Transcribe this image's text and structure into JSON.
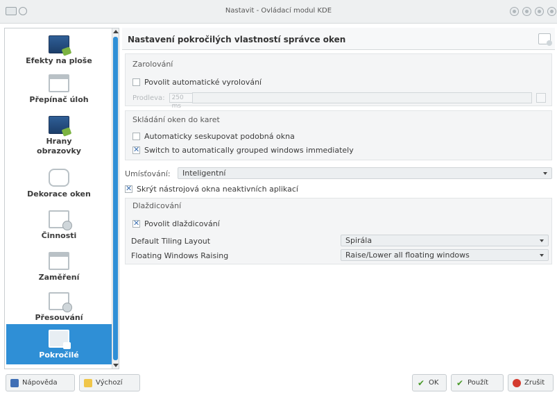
{
  "window": {
    "title": "Nastavit - Ovládací modul KDE"
  },
  "sidebar": {
    "items": [
      {
        "label": "Efekty na ploše",
        "icon": "monitor-effects-icon"
      },
      {
        "label": "Přepínač úloh",
        "icon": "window-switcher-icon"
      },
      {
        "label": "Hrany obrazovky",
        "icon": "screen-edges-icon"
      },
      {
        "label": "Dekorace oken",
        "icon": "window-decoration-icon"
      },
      {
        "label": "Činnosti",
        "icon": "actions-icon"
      },
      {
        "label": "Zaměření",
        "icon": "focus-icon"
      },
      {
        "label": "Přesouvání",
        "icon": "moving-icon"
      },
      {
        "label": "Pokročilé",
        "icon": "advanced-icon",
        "selected": true
      }
    ]
  },
  "main": {
    "title": "Nastavení pokročilých vlastností správce oken",
    "shading": {
      "title": "Zarolování",
      "auto_unshade": {
        "label": "Povolit automatické vyrolování",
        "checked": false
      },
      "delay_label": "Prodleva:",
      "delay_value": "250 ms"
    },
    "tabbing": {
      "title": "Skládání oken do karet",
      "auto_group": {
        "label": "Automaticky seskupovat podobná okna",
        "checked": false
      },
      "switch_group": {
        "label": "Switch to automatically grouped windows immediately",
        "checked": true
      }
    },
    "placement": {
      "label": "Umísťování:",
      "value": "Inteligentní"
    },
    "hide_utility": {
      "label": "Skrýt nástrojová okna neaktivních aplikací",
      "checked": true
    },
    "tiling": {
      "title": "Dlaždicování",
      "enable": {
        "label": "Povolit dlaždicování",
        "checked": true
      },
      "layout_label": "Default Tiling Layout",
      "layout_value": "Spirála",
      "raising_label": "Floating Windows Raising",
      "raising_value": "Raise/Lower all floating windows"
    }
  },
  "buttons": {
    "help": "Nápověda",
    "defaults": "Výchozí",
    "ok": "OK",
    "apply": "Použít",
    "cancel": "Zrušit"
  },
  "colors": {
    "accent": "#2f8fd6"
  }
}
